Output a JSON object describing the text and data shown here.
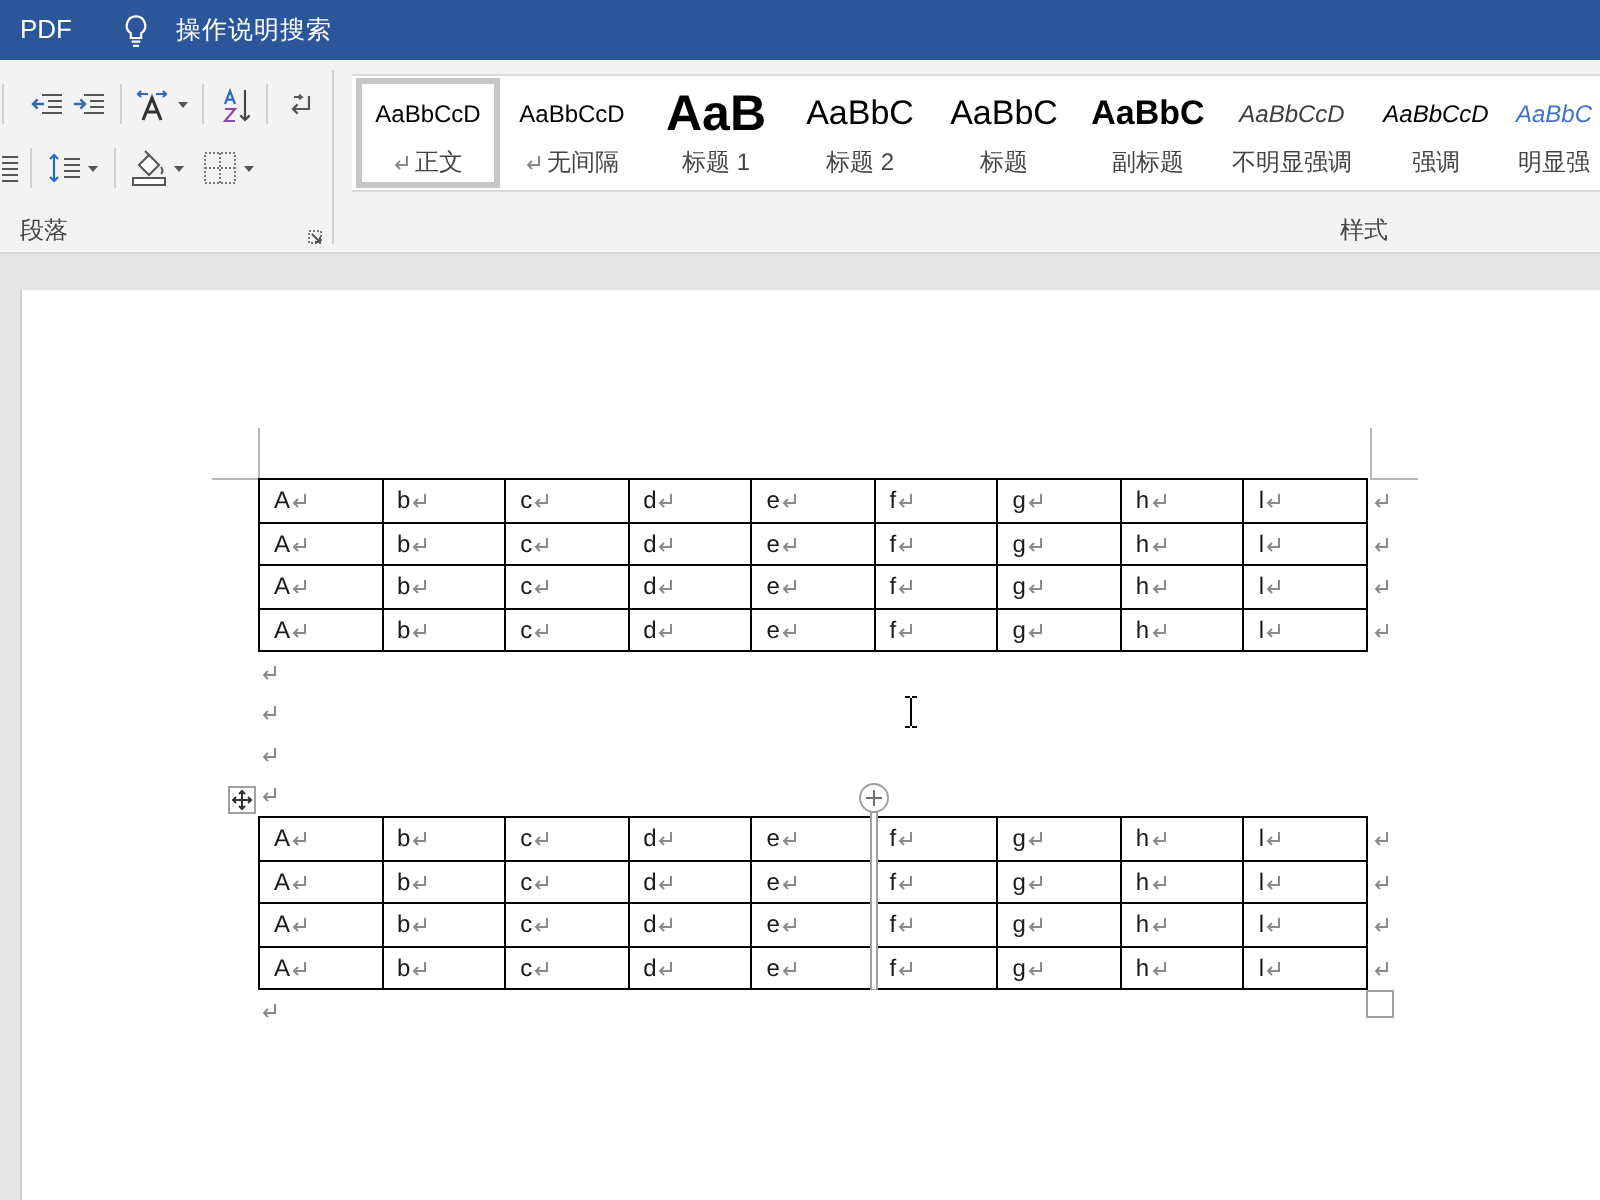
{
  "title_bar": {
    "tab_label": "PDF",
    "tell_me": "操作说明搜索"
  },
  "ribbon": {
    "paragraph_group": {
      "label": "段落"
    },
    "styles_group": {
      "label": "样式",
      "styles": [
        {
          "kind": "normal",
          "preview": "AaBbCcD",
          "label": "正文",
          "paragraph_mark": true,
          "selected": true
        },
        {
          "kind": "no_spacing",
          "preview": "AaBbCcD",
          "label": "无间隔",
          "paragraph_mark": true,
          "selected": false
        },
        {
          "kind": "heading1",
          "preview": "AaB",
          "label": "标题 1",
          "paragraph_mark": false,
          "selected": false
        },
        {
          "kind": "heading2",
          "preview": "AaBbC",
          "label": "标题 2",
          "paragraph_mark": false,
          "selected": false
        },
        {
          "kind": "title",
          "preview": "AaBbC",
          "label": "标题",
          "paragraph_mark": false,
          "selected": false
        },
        {
          "kind": "subtitle",
          "preview": "AaBbC",
          "label": "副标题",
          "paragraph_mark": false,
          "selected": false
        },
        {
          "kind": "subtle_emphasis",
          "preview": "AaBbCcD",
          "label": "不明显强调",
          "paragraph_mark": false,
          "selected": false
        },
        {
          "kind": "emphasis",
          "preview": "AaBbCcD",
          "label": "强调",
          "paragraph_mark": false,
          "selected": false
        },
        {
          "kind": "intense_emphasis",
          "preview": "AaBbC",
          "label": "明显强",
          "paragraph_mark": false,
          "selected": false
        }
      ]
    }
  },
  "document": {
    "show_formatting_marks": true,
    "blocks": [
      {
        "kind": "table",
        "hovered": false,
        "rows": [
          [
            "A",
            "b",
            "c",
            "d",
            "e",
            "f",
            "g",
            "h",
            "l"
          ],
          [
            "A",
            "b",
            "c",
            "d",
            "e",
            "f",
            "g",
            "h",
            "l"
          ],
          [
            "A",
            "b",
            "c",
            "d",
            "e",
            "f",
            "g",
            "h",
            "l"
          ],
          [
            "A",
            "b",
            "c",
            "d",
            "e",
            "f",
            "g",
            "h",
            "l"
          ]
        ]
      },
      {
        "kind": "paragraph"
      },
      {
        "kind": "paragraph"
      },
      {
        "kind": "paragraph"
      },
      {
        "kind": "paragraph"
      },
      {
        "kind": "table",
        "hovered": true,
        "rows": [
          [
            "A",
            "b",
            "c",
            "d",
            "e",
            "f",
            "g",
            "h",
            "l"
          ],
          [
            "A",
            "b",
            "c",
            "d",
            "e",
            "f",
            "g",
            "h",
            "l"
          ],
          [
            "A",
            "b",
            "c",
            "d",
            "e",
            "f",
            "g",
            "h",
            "l"
          ],
          [
            "A",
            "b",
            "c",
            "d",
            "e",
            "f",
            "g",
            "h",
            "l"
          ]
        ]
      },
      {
        "kind": "paragraph"
      }
    ]
  }
}
